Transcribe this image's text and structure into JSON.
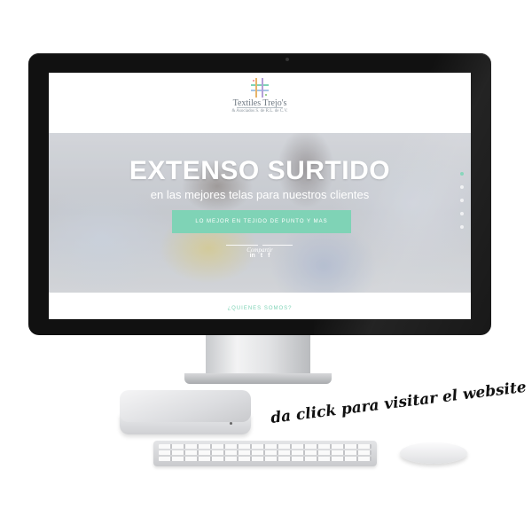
{
  "site": {
    "logo_name": "Textiles Trejo's",
    "logo_subtitle": "& Asociados S. de R.L. de C.V.",
    "hero_title": "EXTENSO SURTIDO",
    "hero_subtitle": "en las mejores telas para nuestros clientes",
    "hero_button": "LO MEJOR EN TEJIDO DE PUNTO Y MAS",
    "share_label": "Compartir",
    "social_icons": [
      "linkedin-icon",
      "twitter-icon",
      "facebook-icon"
    ],
    "social_glyphs": [
      "in",
      "t",
      "f"
    ],
    "quienes_link": "¿QUIENES SOMOS?",
    "accent_color": "#7fd3b6"
  },
  "cta": {
    "text": "da click para visitar el website"
  }
}
